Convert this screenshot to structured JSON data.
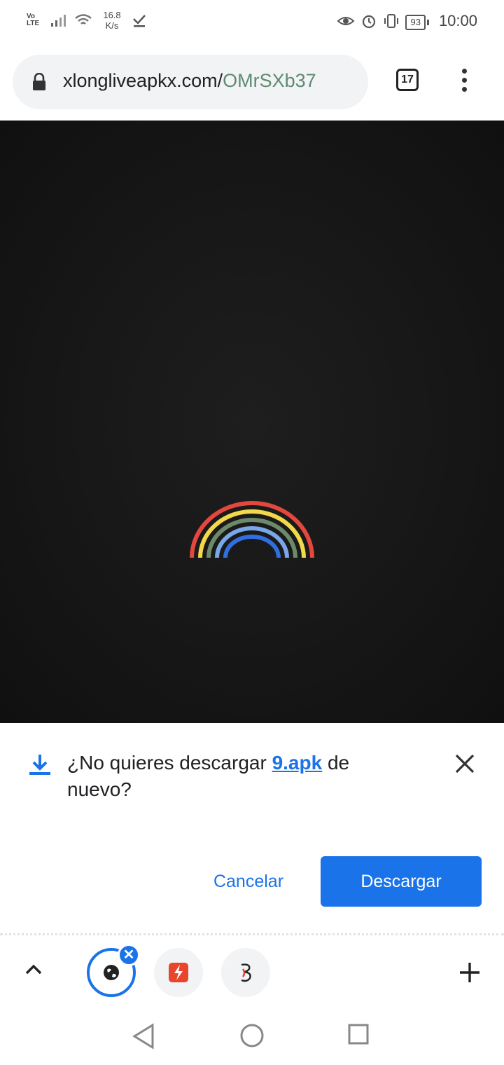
{
  "status_bar": {
    "network_label": "Vo LTE",
    "speed_value": "16.8",
    "speed_unit": "K/s",
    "battery_level": "93",
    "time": "10:00"
  },
  "browser": {
    "url_domain": "xlongliveapkx.com/",
    "url_path": "OMrSXb37",
    "tab_count": "17"
  },
  "download_prompt": {
    "text_before": "¿No quieres descargar ",
    "file_name": "9.apk",
    "text_after": " de nuevo?",
    "cancel_label": "Cancelar",
    "download_label": "Descargar"
  },
  "tab_strip": {
    "close_glyph": "✕"
  },
  "icons": [
    "lock-icon",
    "download-icon",
    "close-icon",
    "chevron-up-icon",
    "globe-icon",
    "plus-icon",
    "back-icon",
    "home-icon",
    "recent-apps-icon"
  ],
  "colors": {
    "accent": "#1a73e8",
    "page_background": "#161616",
    "rainbow": [
      "#e4473d",
      "#f2d94a",
      "#6c8a6a",
      "#7aa7e8",
      "#2f6fe0"
    ]
  }
}
